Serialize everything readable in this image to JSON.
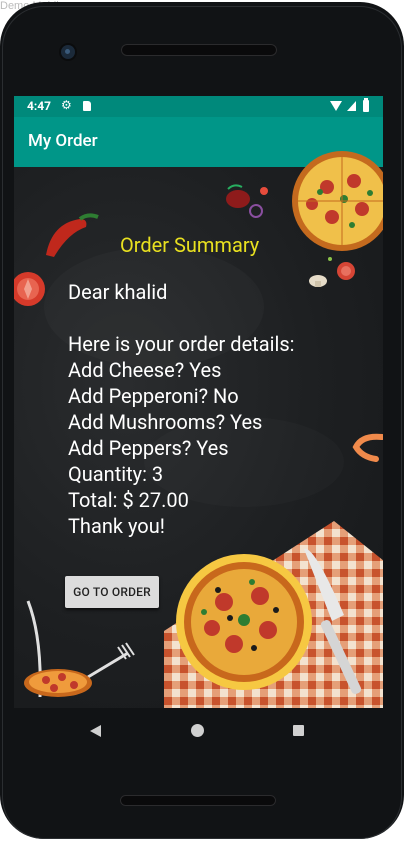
{
  "emulator_label": "Demo Mobil",
  "status_bar": {
    "time": "4:47"
  },
  "app_bar": {
    "title": "My Order"
  },
  "summary": {
    "heading": "Order Summary",
    "greeting": "Dear khalid",
    "intro": "Here is your order details:",
    "lines": [
      "Add Cheese? Yes",
      "Add Pepperoni? No",
      "Add Mushrooms? Yes",
      "Add Peppers? Yes",
      "Quantity: 3",
      "Total: $ 27.00",
      "Thank you!"
    ]
  },
  "actions": {
    "go_to_order_label": "GO TO ORDER"
  },
  "colors": {
    "toolbar": "#009688",
    "status_bar": "#00897b",
    "heading": "#e8e020",
    "background": "#1e2022"
  },
  "icons": {
    "status": [
      "gear-icon",
      "sd-card-icon",
      "wifi-icon",
      "signal-icon",
      "battery-icon"
    ],
    "nav": [
      "back-icon",
      "home-icon",
      "recents-icon"
    ]
  }
}
